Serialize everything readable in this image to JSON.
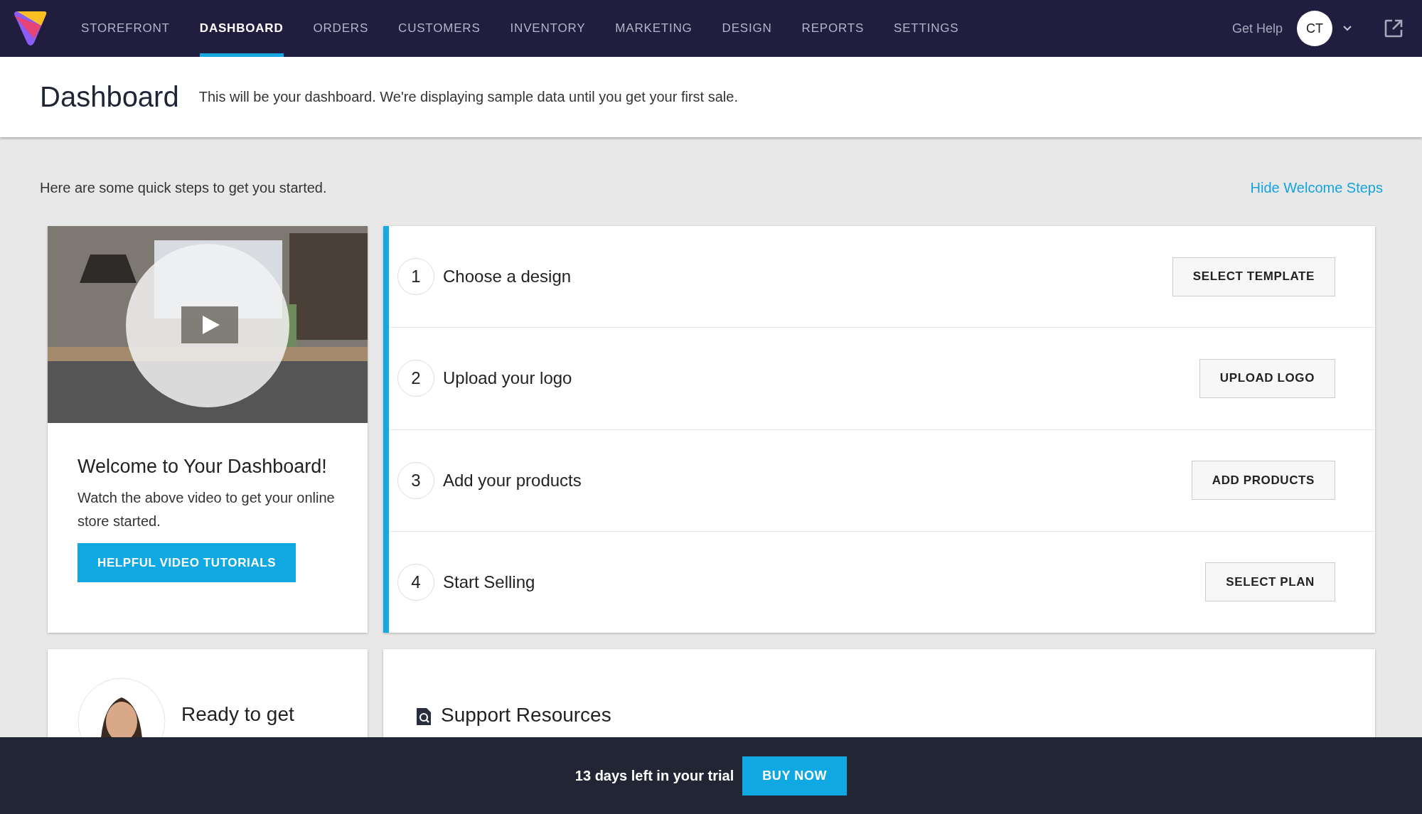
{
  "nav": {
    "items": [
      {
        "label": "STOREFRONT",
        "selected": false
      },
      {
        "label": "DASHBOARD",
        "selected": true
      },
      {
        "label": "ORDERS",
        "selected": false
      },
      {
        "label": "CUSTOMERS",
        "selected": false
      },
      {
        "label": "INVENTORY",
        "selected": false
      },
      {
        "label": "MARKETING",
        "selected": false
      },
      {
        "label": "DESIGN",
        "selected": false
      },
      {
        "label": "REPORTS",
        "selected": false
      },
      {
        "label": "SETTINGS",
        "selected": false
      }
    ],
    "help": "Get Help",
    "avatar": "CT"
  },
  "header": {
    "title": "Dashboard",
    "subtitle": "This will be your dashboard. We're displaying sample data until you get your first sale."
  },
  "intro": {
    "text": "Here are some quick steps to get you started.",
    "hide_link": "Hide Welcome Steps"
  },
  "welcome": {
    "title": "Welcome to Your Dashboard!",
    "text": "Watch the above video to get your online store started.",
    "button": "HELPFUL VIDEO TUTORIALS"
  },
  "steps": [
    {
      "number": "1",
      "label": "Choose a design",
      "button": "SELECT TEMPLATE"
    },
    {
      "number": "2",
      "label": "Upload your logo",
      "button": "UPLOAD LOGO"
    },
    {
      "number": "3",
      "label": "Add your products",
      "button": "ADD PRODUCTS"
    },
    {
      "number": "4",
      "label": "Start Selling",
      "button": "SELECT PLAN"
    }
  ],
  "ready_card": {
    "title": "Ready to get"
  },
  "support": {
    "title": "Support Resources"
  },
  "footer": {
    "text": "13 days left in your trial",
    "button": "BUY NOW"
  }
}
